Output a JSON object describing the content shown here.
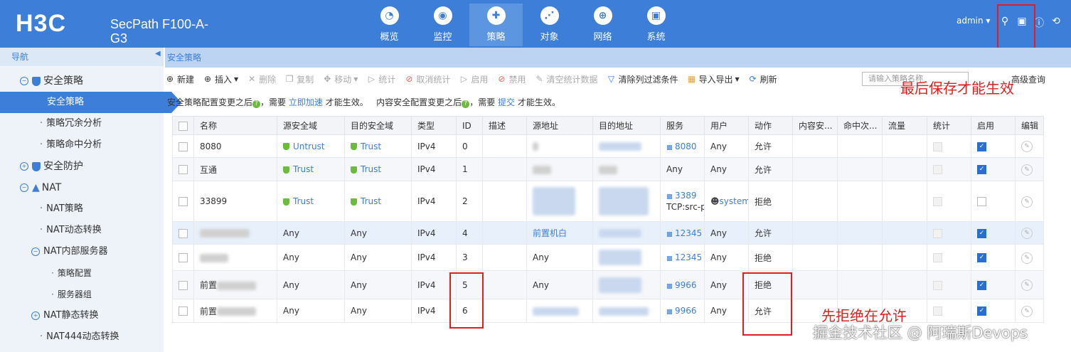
{
  "header": {
    "logo": "H3C",
    "product": "SecPath F100-A-G3",
    "nav": [
      {
        "label": "概览",
        "icon": "dashboard-icon",
        "glyph": "◔"
      },
      {
        "label": "监控",
        "icon": "monitor-icon",
        "glyph": "◉"
      },
      {
        "label": "策略",
        "icon": "policy-shield-icon",
        "glyph": "✚",
        "active": true
      },
      {
        "label": "对象",
        "icon": "share-icon",
        "glyph": "⋰"
      },
      {
        "label": "网络",
        "icon": "globe-icon",
        "glyph": "⊕"
      },
      {
        "label": "系统",
        "icon": "system-icon",
        "glyph": "▣"
      }
    ],
    "user": "admin ▾",
    "icons": [
      "search-icon",
      "save-icon",
      "info-icon",
      "logout-icon"
    ]
  },
  "sidebar": {
    "title": "导航",
    "items": [
      {
        "label": "安全策略"
      },
      {
        "label": "安全策略"
      },
      {
        "label": "策略冗余分析"
      },
      {
        "label": "策略命中分析"
      },
      {
        "label": "安全防护"
      },
      {
        "label": "NAT"
      },
      {
        "label": "NAT策略"
      },
      {
        "label": "NAT动态转换"
      },
      {
        "label": "NAT内部服务器"
      },
      {
        "label": "策略配置"
      },
      {
        "label": "服务器组"
      },
      {
        "label": "NAT静态转换"
      },
      {
        "label": "NAT444动态转换"
      }
    ]
  },
  "breadcrumb": "安全策略",
  "toolbar": {
    "new": "新建",
    "insert": "插入",
    "delete": "删除",
    "copy": "复制",
    "move": "移动",
    "stats": "统计",
    "cancel_stats": "取消统计",
    "enable": "启用",
    "disable": "禁用",
    "clear_stats": "清空统计数据",
    "clear_filter": "清除列过滤条件",
    "import_export": "导入导出",
    "refresh": "刷新",
    "search_placeholder": "请输入策略名称",
    "advanced": "高级查询"
  },
  "notice": {
    "p1": "安全策略配置变更之后",
    "p2": "，需要",
    "link1": "立即加速",
    "p3": "才能生效。",
    "p4": "内容安全配置变更之后",
    "p5": "，需要",
    "link2": "提交",
    "p6": "才能生效。"
  },
  "table": {
    "headers": [
      "名称",
      "源安全域",
      "目的安全域",
      "类型",
      "ID",
      "描述",
      "源地址",
      "目的地址",
      "服务",
      "用户",
      "动作",
      "内容安...",
      "命中次...",
      "流量",
      "统计",
      "启用",
      "编辑"
    ],
    "rows": [
      {
        "name": "8080",
        "src_zone": "Untrust",
        "dst_zone": "Trust",
        "type": "IPv4",
        "id": "0",
        "service": "8080",
        "user": "Any",
        "action": "允许",
        "enabled": true
      },
      {
        "name": "互通",
        "src_zone": "Trust",
        "dst_zone": "Trust",
        "type": "IPv4",
        "id": "1",
        "service": "Any",
        "user": "Any",
        "action": "允许",
        "enabled": true
      },
      {
        "name": "33899",
        "src_zone": "Trust",
        "dst_zone": "Trust",
        "type": "IPv4",
        "id": "2",
        "service": "3389",
        "service2": "TCP:src-p",
        "user": "system",
        "action": "拒绝",
        "enabled": false
      },
      {
        "name": "",
        "src_zone": "Any",
        "dst_zone": "Any",
        "type": "IPv4",
        "id": "4",
        "src_addr": "前置机白",
        "service": "12345",
        "user": "Any",
        "action": "允许",
        "enabled": true
      },
      {
        "name": "",
        "src_zone": "Any",
        "dst_zone": "Any",
        "type": "IPv4",
        "id": "3",
        "src_addr": "Any",
        "service": "12345",
        "user": "Any",
        "action": "拒绝",
        "enabled": true
      },
      {
        "name": "前置",
        "src_zone": "Any",
        "dst_zone": "Any",
        "type": "IPv4",
        "id": "5",
        "src_addr": "Any",
        "service": "9966",
        "user": "Any",
        "action": "拒绝",
        "enabled": true
      },
      {
        "name": "前置",
        "src_zone": "Any",
        "dst_zone": "Any",
        "type": "IPv4",
        "id": "6",
        "src_addr": "",
        "service": "9966",
        "user": "Any",
        "action": "允许",
        "enabled": true
      }
    ]
  },
  "annotations": {
    "save_note": "最后保存才能生效",
    "order_note": "先拒绝在允许"
  },
  "watermark": "掘金技术社区 @ 阿瑞斯Devops",
  "colors": {
    "brand": "#3d7ed8",
    "allow": "#2c9a2c",
    "deny": "#e02020",
    "highlight": "#e02020"
  }
}
